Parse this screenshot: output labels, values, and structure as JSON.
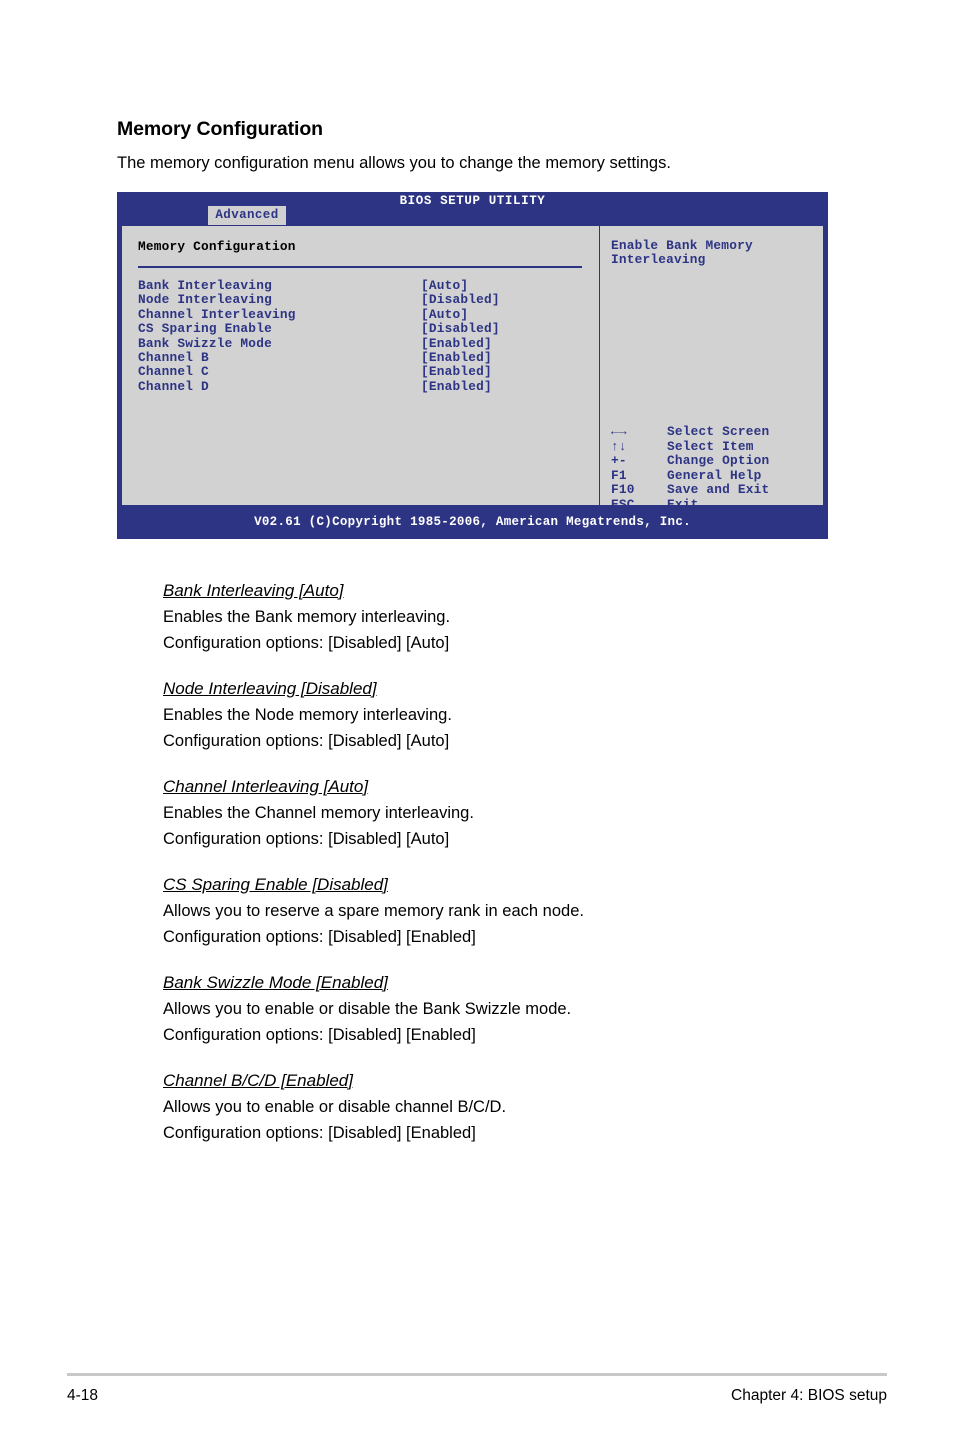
{
  "page": {
    "heading": "Memory Configuration",
    "intro": "The memory configuration menu allows you to change the memory settings.",
    "footer_page_number": "4-18",
    "footer_chapter": "Chapter 4: BIOS setup"
  },
  "colors": {
    "bios_blue": "#2d3484",
    "bios_gray": "#d2d2d2",
    "tab_gray": "#d0d0d0",
    "rule_gray": "#c8c8c8"
  },
  "bios": {
    "title": "BIOS SETUP UTILITY",
    "active_tab": "Advanced",
    "section_title": "Memory Configuration",
    "options": [
      {
        "label": "Bank Interleaving",
        "value": "[Auto]"
      },
      {
        "label": "Node Interleaving",
        "value": "[Disabled]"
      },
      {
        "label": "Channel Interleaving",
        "value": "[Auto]"
      },
      {
        "label": "CS Sparing Enable",
        "value": "[Disabled]"
      },
      {
        "label": "Bank Swizzle Mode",
        "value": "[Enabled]"
      },
      {
        "label": "Channel B",
        "value": "[Enabled]"
      },
      {
        "label": "Channel C",
        "value": "[Enabled]"
      },
      {
        "label": "Channel D",
        "value": "[Enabled]"
      }
    ],
    "help_text": "Enable Bank Memory Interleaving",
    "keys": [
      {
        "key": "←→",
        "desc": "Select Screen",
        "icon": "left-right-arrow-icon"
      },
      {
        "key": "↑↓",
        "desc": "Select Item",
        "icon": "up-down-arrow-icon"
      },
      {
        "key": "+-",
        "desc": "Change Option",
        "icon": "plus-minus-icon"
      },
      {
        "key": "F1",
        "desc": "General Help",
        "icon": "f1-key-icon"
      },
      {
        "key": "F10",
        "desc": "Save and Exit",
        "icon": "f10-key-icon"
      },
      {
        "key": "ESC",
        "desc": "Exit",
        "icon": "esc-key-icon"
      }
    ],
    "footer": "V02.61 (C)Copyright 1985-2006, American Megatrends, Inc."
  },
  "descriptions": [
    {
      "title": "Bank Interleaving [Auto]",
      "body": "Enables the Bank memory interleaving.",
      "options": "Configuration options: [Disabled] [Auto]"
    },
    {
      "title": "Node Interleaving [Disabled]",
      "body": "Enables the Node memory interleaving.",
      "options": "Configuration options: [Disabled] [Auto]"
    },
    {
      "title": "Channel Interleaving [Auto]",
      "body": "Enables the Channel memory interleaving.",
      "options": "Configuration options: [Disabled] [Auto]"
    },
    {
      "title": "CS Sparing Enable [Disabled]",
      "body": "Allows you to reserve a spare memory rank in each node.",
      "options": "Configuration options: [Disabled] [Enabled]"
    },
    {
      "title": "Bank Swizzle Mode [Enabled]",
      "body": "Allows you to enable or disable the Bank Swizzle mode.",
      "options": "Configuration options: [Disabled] [Enabled]"
    },
    {
      "title": "Channel B/C/D [Enabled]",
      "body": "Allows you to enable or disable channel B/C/D.",
      "options": "Configuration options: [Disabled] [Enabled]"
    }
  ]
}
